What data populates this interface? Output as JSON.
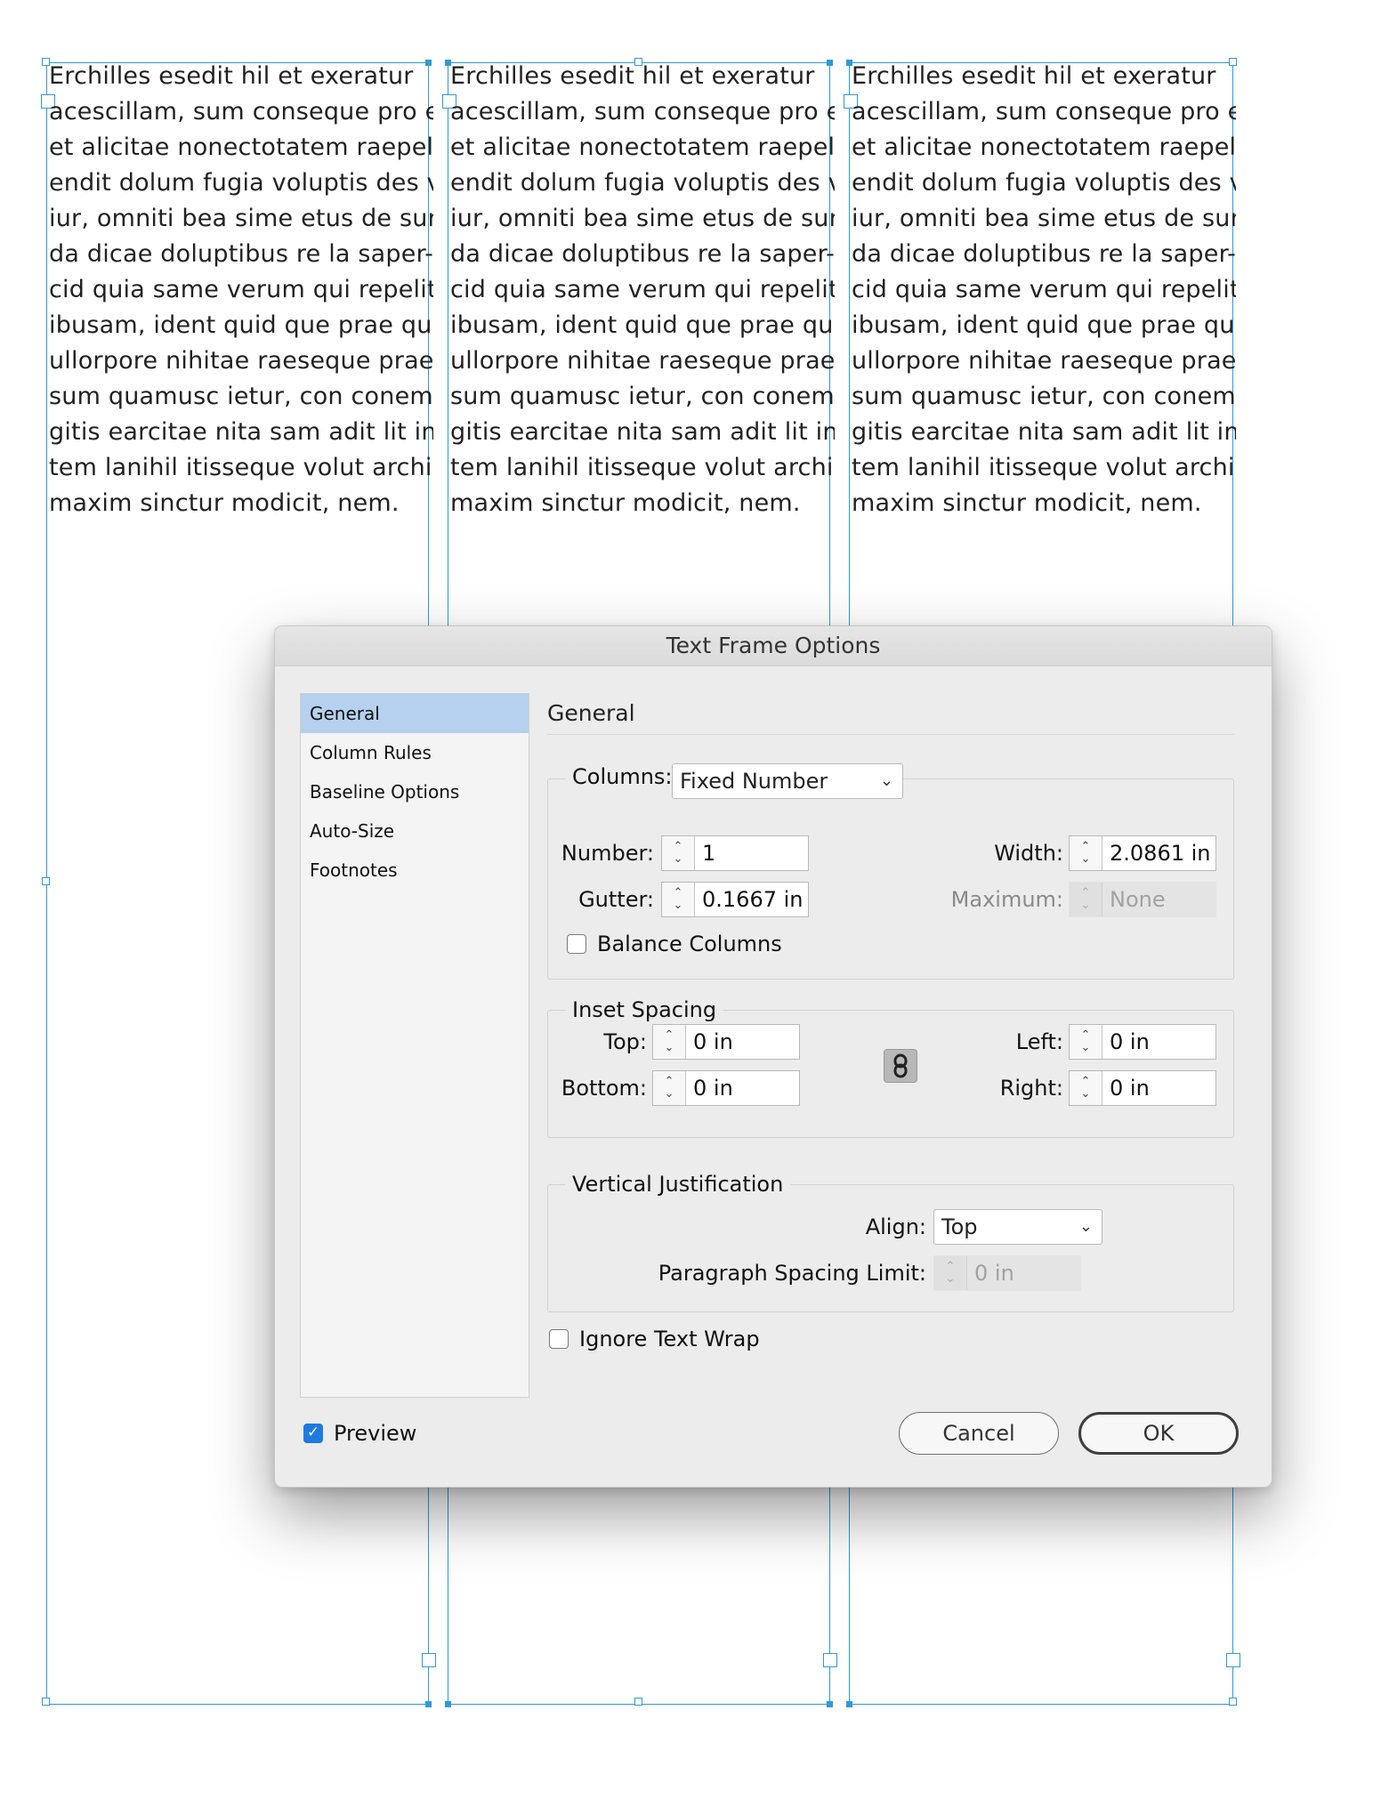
{
  "document": {
    "columns": [
      [
        "Erchilles esedit hil et exeratur",
        "acescillam, sum conseque pro earia",
        "et alicitae nonectotatem raepeli ci-",
        "endit dolum fugia voluptis des vel",
        "iur, omniti bea sime etus de sun-",
        "da dicae doluptibus re la saper-",
        "cid quia same verum qui repelit",
        "ibusam, ident quid que prae qui",
        "ullorpore nihitae raeseque prae",
        "sum quamusc ietur, con conem fu-",
        "gitis earcitae nita sam adit lit in pro",
        "tem lanihil itisseque volut archil",
        "maxim sinctur modicit, nem."
      ],
      [
        "Erchilles esedit hil et exeratur",
        "acescillam, sum conseque pro earia",
        "et alicitae nonectotatem raepeli ci-",
        "endit dolum fugia voluptis des vel",
        "iur, omniti bea sime etus de sun-",
        "da dicae doluptibus re la saper-",
        "cid quia same verum qui repelit",
        "ibusam, ident quid que prae qui",
        "ullorpore nihitae raeseque prae",
        "sum quamusc ietur, con conem fu-",
        "gitis earcitae nita sam adit lit in pro",
        "tem lanihil itisseque volut archil",
        "maxim sinctur modicit, nem."
      ],
      [
        "Erchilles esedit hil et exeratur",
        "acescillam, sum conseque pro earia",
        "et alicitae nonectotatem raepeli ci-",
        "endit dolum fugia voluptis des vel",
        "iur, omniti bea sime etus de sun-",
        "da dicae doluptibus re la saper-",
        "cid quia same verum qui repelit",
        "ibusam, ident quid que prae qui",
        "ullorpore nihitae raeseque prae",
        "sum quamusc ietur, con conem fu-",
        "gitis earcitae nita sam adit lit in pro",
        "tem lanihil itisseque volut archil",
        "maxim sinctur modicit, nem."
      ]
    ]
  },
  "dialog": {
    "title": "Text Frame Options",
    "sidebar": {
      "items": [
        {
          "label": "General",
          "active": true
        },
        {
          "label": "Column Rules",
          "active": false
        },
        {
          "label": "Baseline Options",
          "active": false
        },
        {
          "label": "Auto-Size",
          "active": false
        },
        {
          "label": "Footnotes",
          "active": false
        }
      ]
    },
    "panel_title": "General",
    "columns": {
      "label": "Columns:",
      "mode": "Fixed Number",
      "number_label": "Number:",
      "number": "1",
      "gutter_label": "Gutter:",
      "gutter": "0.1667 in",
      "width_label": "Width:",
      "width": "2.0861 in",
      "maximum_label": "Maximum:",
      "maximum": "None",
      "balance_label": "Balance Columns",
      "balance_checked": false
    },
    "inset": {
      "legend": "Inset Spacing",
      "top_label": "Top:",
      "top": "0 in",
      "bottom_label": "Bottom:",
      "bottom": "0 in",
      "left_label": "Left:",
      "left": "0 in",
      "right_label": "Right:",
      "right": "0 in",
      "chain_icon": "chain-link-icon"
    },
    "vertical": {
      "legend": "Vertical Justification",
      "align_label": "Align:",
      "align": "Top",
      "para_label": "Paragraph Spacing Limit:",
      "para": "0 in"
    },
    "ignore_wrap_label": "Ignore Text Wrap",
    "ignore_wrap_checked": false,
    "preview_label": "Preview",
    "preview_checked": true,
    "cancel_label": "Cancel",
    "ok_label": "OK"
  },
  "colors": {
    "frame": "#2f9ad6",
    "selection": "#b5d1ef",
    "check": "#1f7ae0"
  }
}
